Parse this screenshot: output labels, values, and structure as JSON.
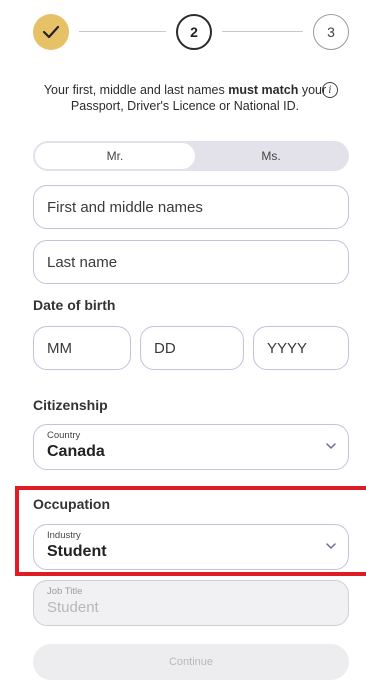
{
  "stepper": {
    "step2_label": "2",
    "step3_label": "3",
    "done_color": "#e6c167"
  },
  "notice": {
    "text_before": "Your first, middle and last names ",
    "text_bold": "must match",
    "text_after": " your Passport, Driver's Licence or National ID.",
    "info_icon": "info-icon"
  },
  "title_toggle": {
    "options": [
      "Mr.",
      "Ms."
    ],
    "selected": "Mr."
  },
  "name": {
    "first_placeholder": "First and middle names",
    "last_placeholder": "Last name"
  },
  "dob": {
    "label": "Date of birth",
    "mm_placeholder": "MM",
    "dd_placeholder": "DD",
    "yyyy_placeholder": "YYYY"
  },
  "citizenship": {
    "label": "Citizenship",
    "country_small_label": "Country",
    "country_value": "Canada"
  },
  "occupation": {
    "label": "Occupation",
    "industry_small_label": "Industry",
    "industry_value": "Student",
    "job_title_small_label": "Job Title",
    "job_title_value": "Student",
    "highlight_color": "#e01b23"
  },
  "actions": {
    "continue_label": "Continue"
  },
  "colors": {
    "field_border": "#c3c2dd",
    "accent_gold": "#e6c167"
  }
}
